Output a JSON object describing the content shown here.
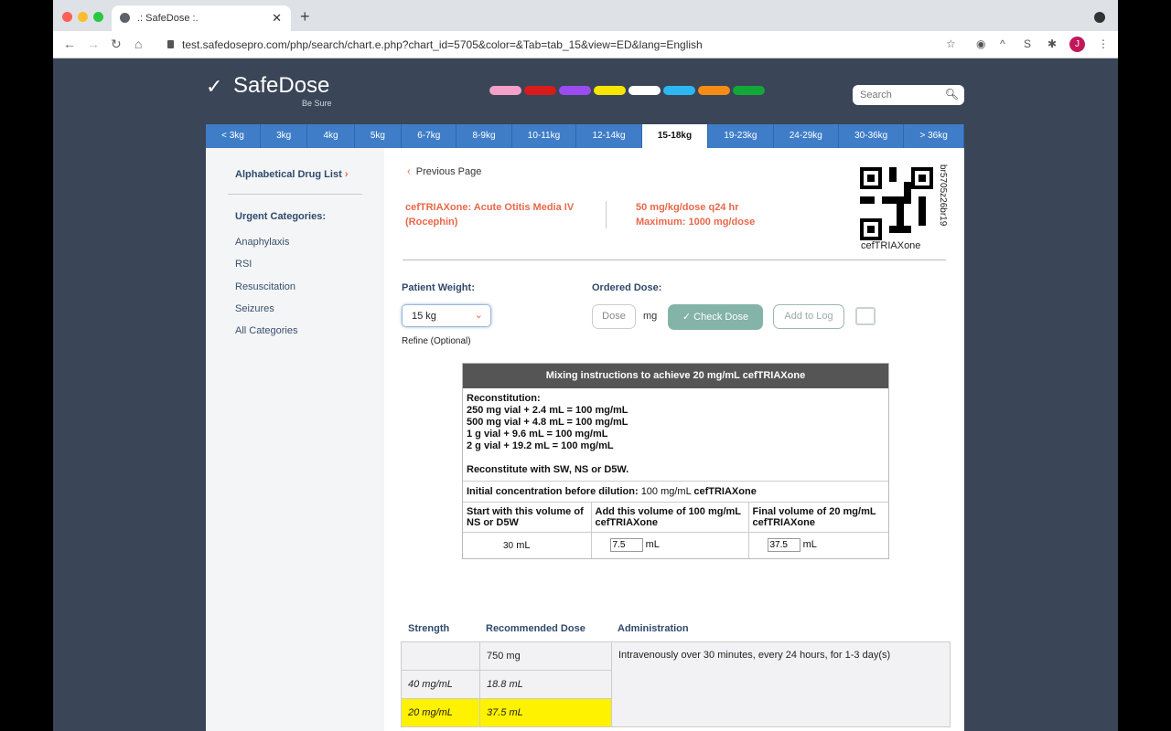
{
  "browser": {
    "tab_title": ".: SafeDose :.",
    "url": "test.safedosepro.com/php/search/chart.e.php?chart_id=5705&color=&Tab=tab_15&view=ED&lang=English",
    "avatar": "J"
  },
  "header": {
    "brand": "SafeDose",
    "tagline": "Be Sure",
    "search_placeholder": "Search",
    "colors": [
      "#f5a0c8",
      "#d81c1c",
      "#9b4cf0",
      "#f7e600",
      "#ffffff",
      "#2cb7f2",
      "#f68b16",
      "#12a838"
    ]
  },
  "weight_tabs": [
    "< 3kg",
    "3kg",
    "4kg",
    "5kg",
    "6-7kg",
    "8-9kg",
    "10-11kg",
    "12-14kg",
    "15-18kg",
    "19-23kg",
    "24-29kg",
    "30-36kg",
    "> 36kg"
  ],
  "active_tab": "15-18kg",
  "sidebar": {
    "alpha": "Alphabetical Drug List",
    "urgent": "Urgent Categories:",
    "items": [
      "Anaphylaxis",
      "RSI",
      "Resuscitation",
      "Seizures",
      "All Categories"
    ]
  },
  "drug": {
    "prev": "Previous Page",
    "name": "cefTRIAXone: Acute Otitis Media IV",
    "brand": "(Rocephin)",
    "dose": "50 mg/kg/dose q24 hr",
    "max": "Maximum: 1000 mg/dose",
    "qr_label": "cefTRIAXone",
    "qr_code": "br5705z26br19"
  },
  "form": {
    "weight_label": "Patient Weight:",
    "weight_value": "15 kg",
    "refine": "Refine (Optional)",
    "ordered_label": "Ordered Dose:",
    "dose_placeholder": "Dose",
    "unit": "mg",
    "check": "Check Dose",
    "add_log": "Add to Log"
  },
  "mixing": {
    "title": "Mixing instructions to achieve 20 mg/mL cefTRIAXone",
    "recon": [
      "Reconstitution:",
      "250 mg vial + 2.4 mL = 100 mg/mL",
      "500 mg vial + 4.8 mL = 100 mg/mL",
      "1 g vial + 9.6 mL = 100 mg/mL",
      "2 g vial + 19.2 mL = 100 mg/mL"
    ],
    "recon_with": "Reconstitute with SW, NS or D5W.",
    "initial_label": "Initial concentration before dilution:",
    "initial_value": "100 mg/mL",
    "initial_drug": "cefTRIAXone",
    "cols": [
      "Start with this volume of NS or D5W",
      "Add this volume of 100 mg/mL cefTRIAXone",
      "Final volume of 20 mg/mL cefTRIAXone"
    ],
    "start": "30",
    "add": "7.5",
    "final": "37.5",
    "unit": "mL"
  },
  "dose_table": {
    "headers": [
      "Strength",
      "Recommended Dose",
      "Administration"
    ],
    "rows": [
      {
        "strength": "",
        "dose": "750 mg"
      },
      {
        "strength": "40 mg/mL",
        "dose": "18.8 mL"
      },
      {
        "strength": "20 mg/mL",
        "dose": "37.5 mL"
      }
    ],
    "admin": "Intravenously over 30 minutes, every 24 hours, for 1-3 day(s)"
  }
}
